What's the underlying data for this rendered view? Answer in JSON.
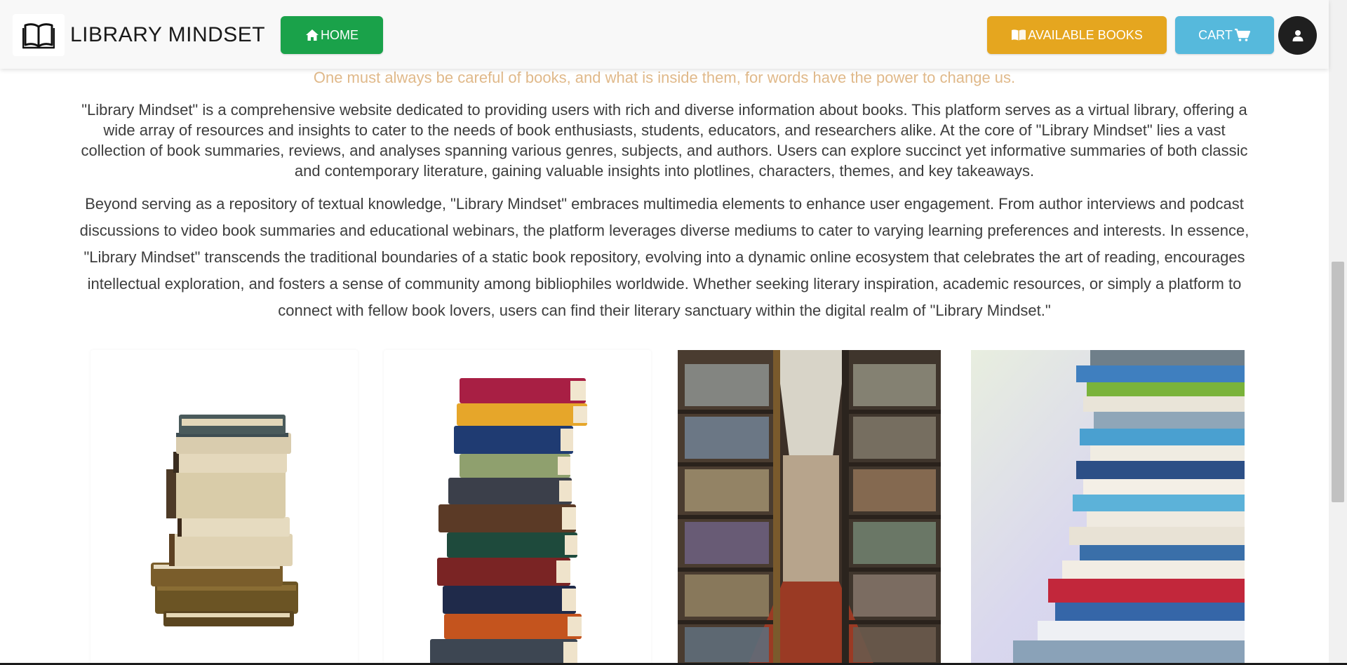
{
  "navbar": {
    "brand": "LIBRARY MINDSET",
    "home_label": "HOME",
    "books_label": "AVAILABLE BOOKS",
    "cart_label": "CART",
    "icons": {
      "brand": "open-book-icon",
      "home": "house-icon",
      "books": "books-icon",
      "cart": "cart-icon",
      "user": "user-icon"
    }
  },
  "content": {
    "quote": "One must always be careful of books, and what is inside them, for words have the power to change us.",
    "paragraph1": "\"Library Mindset\" is a comprehensive website dedicated to providing users with rich and diverse information about books. This platform serves as a virtual library, offering a wide array of resources and insights to cater to the needs of book enthusiasts, students, educators, and researchers alike. At the core of \"Library Mindset\" lies a vast collection of book summaries, reviews, and analyses spanning various genres, subjects, and authors. Users can explore succinct yet informative summaries of both classic and contemporary literature, gaining valuable insights into plotlines, characters, themes, and key takeaways.",
    "paragraph2": "Beyond serving as a repository of textual knowledge, \"Library Mindset\" embraces multimedia elements to enhance user engagement. From author interviews and podcast discussions to video book summaries and educational webinars, the platform leverages diverse mediums to cater to varying learning preferences and interests. In essence, \"Library Mindset\" transcends the traditional boundaries of a static book repository, evolving into a dynamic online ecosystem that celebrates the art of reading, encourages intellectual exploration, and fosters a sense of community among bibliophiles worldwide. Whether seeking literary inspiration, academic resources, or simply a platform to connect with fellow book lovers, users can find their literary sanctuary within the digital realm of \"Library Mindset.\""
  },
  "cards": [
    {
      "image": "old-book-stack-image"
    },
    {
      "image": "colorful-book-stack-image"
    },
    {
      "image": "library-aisle-image"
    },
    {
      "image": "book-pile-photo-image"
    }
  ],
  "colors": {
    "home": "#1aa24a",
    "books": "#e5a61f",
    "cart": "#56b9dc",
    "quote": "#e0b98a",
    "avatar": "#1f1f1f"
  }
}
